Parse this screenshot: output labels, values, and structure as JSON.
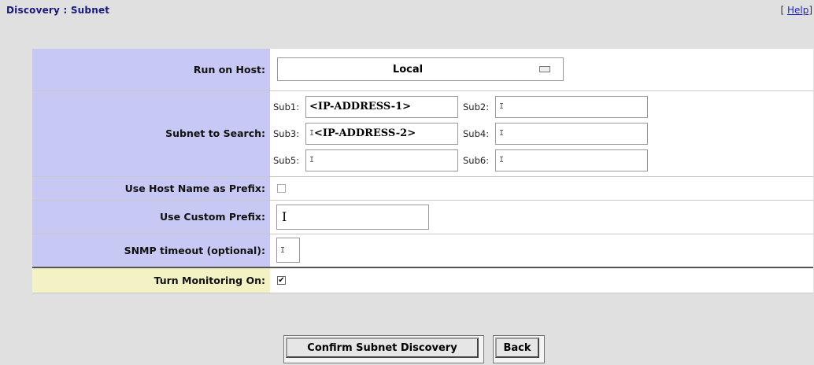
{
  "header": {
    "title": "Discovery : Subnet",
    "help_open": "[",
    "help_label": "Help",
    "help_close": "]"
  },
  "form": {
    "run_on_host": {
      "label": "Run on Host:",
      "value": "Local"
    },
    "subnet_to_search": {
      "label": "Subnet to Search:",
      "subnets": [
        {
          "label": "Sub1:",
          "value": "<IP-ADDRESS-1>"
        },
        {
          "label": "Sub2:",
          "value": ""
        },
        {
          "label": "Sub3:",
          "value": "<IP-ADDRESS-2>"
        },
        {
          "label": "Sub4:",
          "value": ""
        },
        {
          "label": "Sub5:",
          "value": ""
        },
        {
          "label": "Sub6:",
          "value": ""
        }
      ]
    },
    "use_host_name_prefix": {
      "label": "Use Host Name as Prefix:",
      "checked": false
    },
    "use_custom_prefix": {
      "label": "Use Custom Prefix:",
      "value": ""
    },
    "snmp_timeout": {
      "label": "SNMP timeout (optional):",
      "value": ""
    },
    "turn_monitoring_on": {
      "label": "Turn Monitoring On:",
      "checked": true,
      "mark": "✔"
    }
  },
  "buttons": {
    "confirm_label": "Confirm Subnet Discovery",
    "back_label": "Back"
  },
  "colors": {
    "label_bg": "#c8c8f4",
    "monitoring_label_bg": "#f2f2c4",
    "title_color": "#1a1a7a"
  }
}
